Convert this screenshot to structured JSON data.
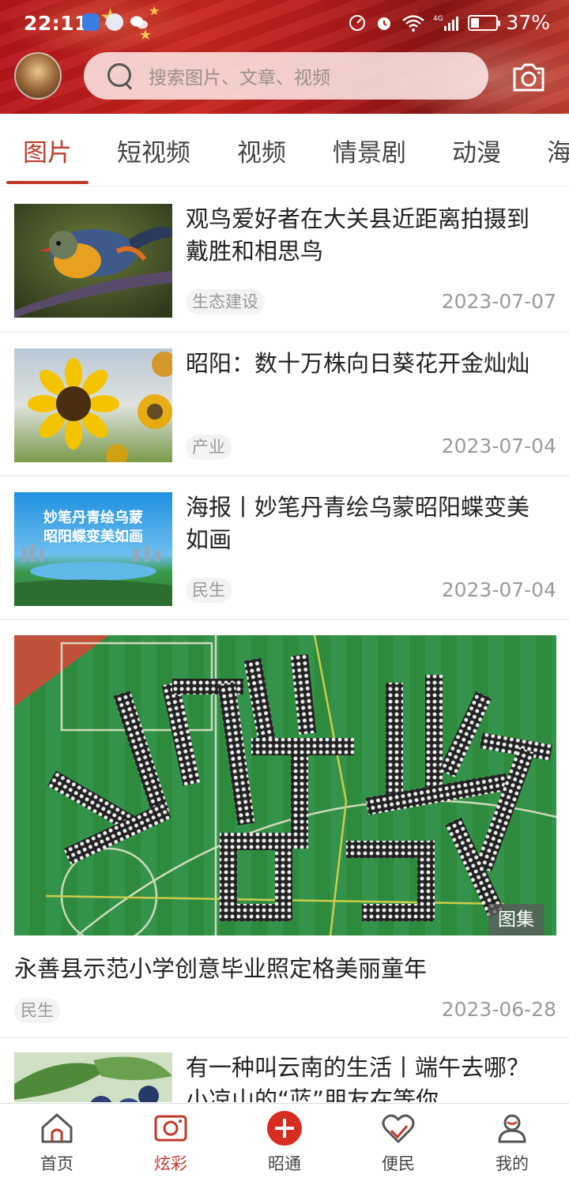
{
  "status_bar": {
    "time": "22:11",
    "battery": "37%",
    "network": "4G"
  },
  "header": {
    "search_placeholder": "搜索图片、文章、视频",
    "brand_color": "#c0392b"
  },
  "tabs": [
    {
      "label": "图片",
      "active": true
    },
    {
      "label": "短视频",
      "active": false
    },
    {
      "label": "视频",
      "active": false
    },
    {
      "label": "情景剧",
      "active": false
    },
    {
      "label": "动漫",
      "active": false
    },
    {
      "label": "海",
      "active": false
    }
  ],
  "articles": [
    {
      "title": "观鸟爱好者在大关县近距离拍摄到戴胜和相思鸟",
      "tag": "生态建设",
      "date": "2023-07-07",
      "image": "bird-photo"
    },
    {
      "title": "昭阳：数十万株向日葵花开金灿灿",
      "tag": "产业",
      "date": "2023-07-04",
      "image": "sunflower-photo"
    },
    {
      "title": "海报丨妙笔丹青绘乌蒙昭阳蝶变美如画",
      "tag": "民生",
      "date": "2023-07-04",
      "image": "poster-image",
      "image_text": "妙笔丹青绘乌蒙 昭阳蝶变美如画"
    },
    {
      "title": "有一种叫云南的生活丨端午去哪？小凉山的“蓝”朋友在等你",
      "image": "blueberry-photo"
    }
  ],
  "featured": {
    "title": "永善县示范小学创意毕业照定格美丽童年",
    "tag": "民生",
    "date": "2023-06-28",
    "badge": "图集",
    "image": "graduation-formation-photo"
  },
  "bottom_nav": [
    {
      "label": "首页",
      "icon": "home-icon",
      "active": false
    },
    {
      "label": "炫彩",
      "icon": "camera-frame-icon",
      "active": true
    },
    {
      "label": "昭通",
      "icon": "plus-circle-icon",
      "active": false
    },
    {
      "label": "便民",
      "icon": "heart-hand-icon",
      "active": false
    },
    {
      "label": "我的",
      "icon": "user-icon",
      "active": false
    }
  ]
}
